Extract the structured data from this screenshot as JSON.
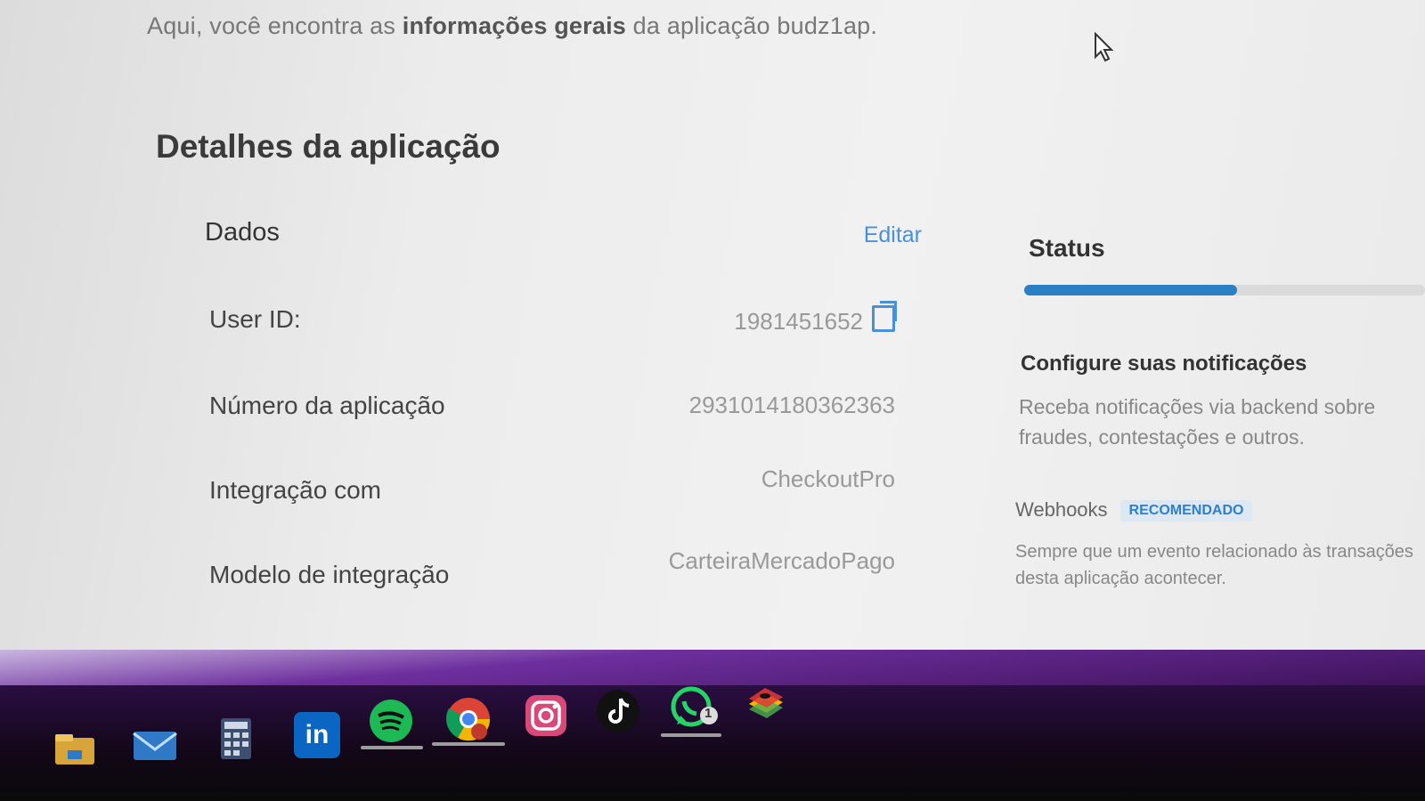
{
  "intro": {
    "prefix": "Aqui, você encontra as ",
    "bold": "informações gerais",
    "suffix": " da aplicação budz1ap."
  },
  "section_title": "Detalhes da aplicação",
  "data_card": {
    "title": "Dados",
    "edit_label": "Editar",
    "rows": [
      {
        "label": "User ID:",
        "value": "1981451652"
      },
      {
        "label": "Número da aplicação",
        "value": "2931014180362363"
      },
      {
        "label": "Integração com",
        "value": "CheckoutPro"
      },
      {
        "label": "Modelo de integração",
        "value": "CarteiraMercadoPago"
      }
    ]
  },
  "status": {
    "title": "Status",
    "progress": 0.53,
    "accent_color": "#2b7fc3"
  },
  "notifications": {
    "title": "Configure suas notificações",
    "description": "Receba notificações via backend sobre fraudes, contestações e outros.",
    "webhooks_label": "Webhooks",
    "badge": "RECOMENDADO",
    "webhooks_description": "Sempre que um evento relacionado às transações desta aplicação acontecer."
  },
  "taskbar": {
    "icons": [
      {
        "name": "file-explorer-icon",
        "color": "#d8a53a"
      },
      {
        "name": "mail-icon",
        "color": "#2f79c6"
      },
      {
        "name": "calculator-icon",
        "color": "#3d4e6e"
      },
      {
        "name": "linkedin-icon",
        "color": "#0a66c2",
        "glyph": "in"
      },
      {
        "name": "spotify-icon",
        "color": "#1db954"
      },
      {
        "name": "chrome-icon",
        "color": "#db4437"
      },
      {
        "name": "instagram-icon",
        "color": "#d8497a"
      },
      {
        "name": "tiktok-icon",
        "color": "#111111"
      },
      {
        "name": "whatsapp-icon",
        "color": "#25d366",
        "badge": "1"
      },
      {
        "name": "bluestacks-icon",
        "color": "#f4b400"
      }
    ]
  }
}
